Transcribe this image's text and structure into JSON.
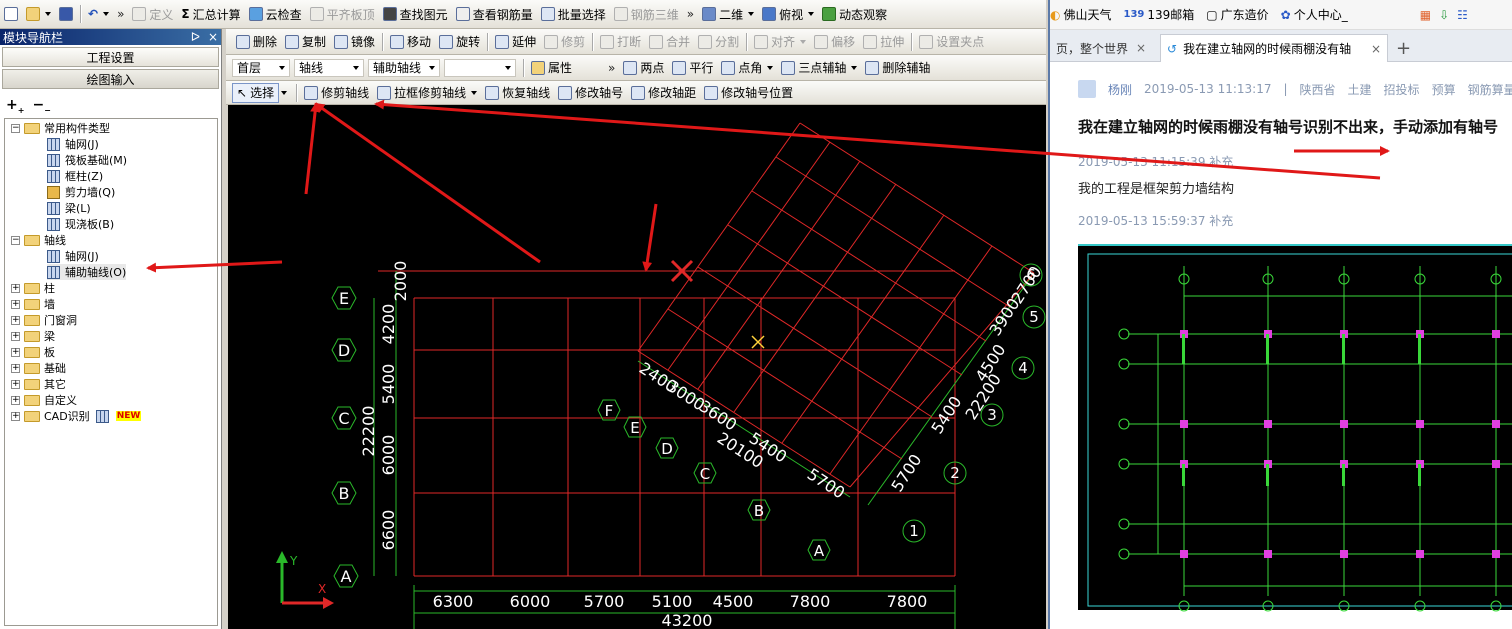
{
  "menu_bar": {
    "items": [
      "定义",
      "汇总计算",
      "云检查",
      "平齐板顶",
      "查找图元",
      "查看钢筋量",
      "批量选择",
      "钢筋三维",
      "二维",
      "俯视",
      "动态观察"
    ],
    "more_1": "»",
    "more_2": "»"
  },
  "toolbar_edit": {
    "items": [
      "删除",
      "复制",
      "镜像",
      "移动",
      "旋转",
      "延伸",
      "修剪",
      "打断",
      "合并",
      "分割",
      "对齐",
      "偏移",
      "拉伸",
      "设置夹点"
    ]
  },
  "toolbar_layer": {
    "floor": "首层",
    "component_type": "轴线",
    "component_sub": "辅助轴线",
    "component_name": "",
    "attributes": "属性",
    "more": "»",
    "tools": [
      "两点",
      "平行",
      "点角",
      "三点辅轴",
      "删除辅轴"
    ]
  },
  "toolbar_axis": {
    "select": "选择",
    "tools": [
      "修剪轴线",
      "拉框修剪轴线",
      "恢复轴线",
      "修改轴号",
      "修改轴距",
      "修改轴号位置"
    ]
  },
  "nav_panel": {
    "title": "模块导航栏",
    "pin": "ᐅ",
    "close": "×",
    "project_settings": "工程设置",
    "drawing_input": "绘图输入",
    "tree": {
      "common": "常用构件类型",
      "common_items": [
        "轴网(J)",
        "筏板基础(M)",
        "框柱(Z)",
        "剪力墙(Q)",
        "梁(L)",
        "现浇板(B)"
      ],
      "axis": "轴线",
      "axis_items": [
        "轴网(J)",
        "辅助轴线(O)"
      ],
      "groups": [
        "柱",
        "墙",
        "门窗洞",
        "梁",
        "板",
        "基础",
        "其它",
        "自定义",
        "CAD识别"
      ],
      "new_badge": "NEW"
    }
  },
  "cad": {
    "top_dims": [
      "6300",
      "6000",
      "5700",
      "5100",
      "4500",
      "7800",
      "7800"
    ],
    "total_dim": "43200",
    "left_dims": [
      "2000",
      "4200",
      "5400",
      "6000",
      "6600"
    ],
    "left_total": "22200",
    "left_axes": [
      "E",
      "D",
      "C",
      "B",
      "A"
    ],
    "rot_axes_letters": [
      "F",
      "E",
      "D",
      "C",
      "B",
      "A"
    ],
    "rot_dims_bottom": [
      "2400",
      "3000",
      "3600",
      "5400",
      "5700"
    ],
    "rot_total_bottom": "20100",
    "rot_axes_numbers": [
      "6",
      "5",
      "4",
      "3",
      "2",
      "1"
    ],
    "rot_dims_right": [
      "3900",
      "2700",
      "4500",
      "5400",
      "5700"
    ],
    "rot_total_right": "22200",
    "ucs_y": "Y",
    "ucs_x": "X"
  },
  "browser": {
    "bookmarks": [
      "佛山天气",
      "139邮箱",
      "广东造价",
      "个人中心_"
    ],
    "tabs": [
      {
        "title": "页，整个世界"
      },
      {
        "title": "我在建立轴网的时候雨棚没有轴"
      }
    ],
    "new_tab": "+",
    "post_author": "杨刚",
    "post_time": "2019-05-13 11:13:17",
    "post_sep": "|",
    "post_region": "陕西省",
    "post_tags": [
      "土建",
      "招投标",
      "预算",
      "钢筋算量GGJ"
    ],
    "post_title": "我在建立轴网的时候雨棚没有轴号识别不出来，手动添加有轴号",
    "supplement_1_time": "2019-05-13 11:15:39 补充",
    "supplement_1_text": "我的工程是框架剪力墙结构",
    "supplement_2_time": "2019-05-13 15:59:37 补充"
  }
}
